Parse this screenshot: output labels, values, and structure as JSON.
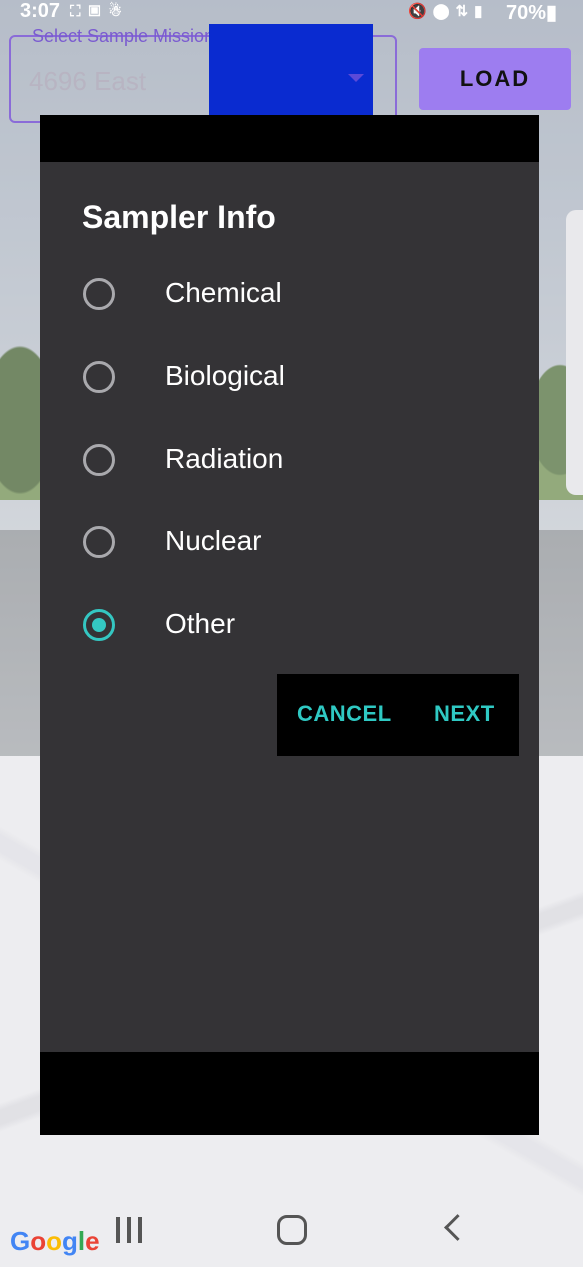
{
  "status_bar": {
    "time": "3:07",
    "left_icons": [
      "screenshot-icon",
      "screen-record-icon",
      "accessibility-icon"
    ],
    "right_icons": [
      "mute-icon",
      "location-icon",
      "lte-icon",
      "signal-icon"
    ],
    "battery": "70%"
  },
  "mission_select": {
    "label": "Select Sample Mission",
    "value": "4696 East"
  },
  "load_button": "LOAD",
  "dialog": {
    "title": "Sampler Info",
    "options": [
      {
        "label": "Chemical",
        "checked": false
      },
      {
        "label": "Biological",
        "checked": false
      },
      {
        "label": "Radiation",
        "checked": false
      },
      {
        "label": "Nuclear",
        "checked": false
      },
      {
        "label": "Other",
        "checked": true
      }
    ],
    "cancel_label": "CANCEL",
    "next_label": "NEXT"
  },
  "nav_bar": {
    "google_logo": "Google",
    "recent_icon": "recent-apps-icon",
    "home_icon": "home-icon",
    "back_icon": "back-icon"
  },
  "colors": {
    "accent": "#34c7c2",
    "dialog_bg": "#343336",
    "load_button_bg": "#9d7df0"
  }
}
